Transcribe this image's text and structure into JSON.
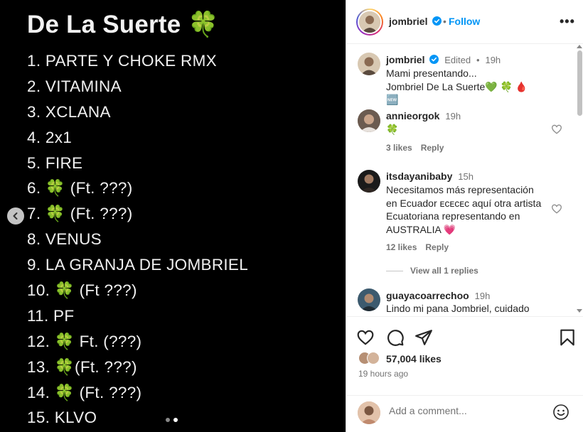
{
  "media": {
    "title": "De La Suerte 🍀",
    "tracks": [
      "1. PARTE Y CHOKE RMX",
      "2. VITAMINA",
      "3. XCLANA",
      "4. 2x1",
      "5. FIRE",
      "6. 🍀 (Ft. ???)",
      "7. 🍀 (Ft. ???)",
      "8. VENUS",
      "9. LA GRANJA DE JOMBRIEL",
      "10. 🍀 (Ft ???)",
      "11. PF",
      "12. 🍀 Ft. (???)",
      "13. 🍀(Ft. ???)",
      "14. 🍀 (Ft. ???)",
      "15. KLVO"
    ],
    "carousel": {
      "current": 2,
      "total": 2
    },
    "prev_icon": "chevron-left-icon"
  },
  "header": {
    "username": "jombriel",
    "separator": "•",
    "follow_label": "Follow",
    "more_icon": "more-horizontal-icon",
    "more_label": "•••"
  },
  "caption": {
    "username": "jombriel",
    "edited": "Edited",
    "separator": "•",
    "time": "19h",
    "line1": "Mami presentando...",
    "line2": "Jombriel De La Suerte💚 🍀 🩸 🆕"
  },
  "comments": [
    {
      "username": "annieorgok",
      "time": "19h",
      "text": "🍀",
      "likes": "3 likes",
      "reply": "Reply"
    },
    {
      "username": "itsdayanibaby",
      "time": "15h",
      "text": "Necesitamos más representación en Ecuador ᴇᴄᴇᴄᴇᴄ aquí otra artista Ecuatoriana representando en AUSTRALIA 💗",
      "likes": "12 likes",
      "reply": "Reply",
      "view_replies": "View all 1 replies"
    },
    {
      "username": "guayacoarrechoo",
      "time": "19h",
      "text": "Lindo mi pana Jombriel, cuidado"
    }
  ],
  "actions": {
    "like_icon": "heart-icon",
    "comment_icon": "comment-icon",
    "share_icon": "share-icon",
    "save_icon": "bookmark-icon"
  },
  "likes": "57,004 likes",
  "posted": "19 hours ago",
  "add_comment": {
    "placeholder": "Add a comment...",
    "emoji_icon": "emoji-icon"
  },
  "colors": {
    "accent": "#0095f6",
    "text": "#262626",
    "muted": "#737373",
    "media_bg": "#000000"
  }
}
